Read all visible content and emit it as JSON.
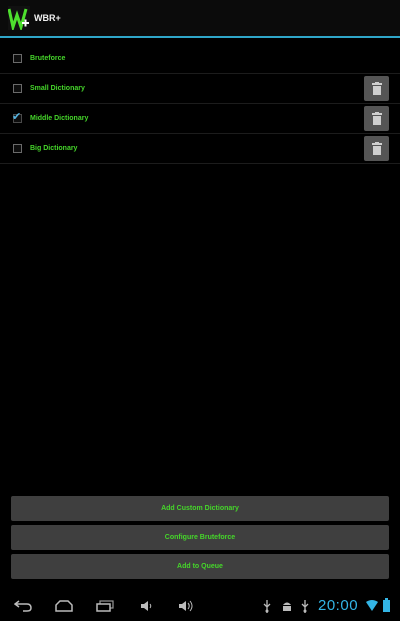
{
  "app": {
    "title": "WBR+"
  },
  "dictionaries": [
    {
      "label": "Bruteforce",
      "checked": false,
      "deletable": false
    },
    {
      "label": "Small Dictionary",
      "checked": false,
      "deletable": true
    },
    {
      "label": "Middle Dictionary",
      "checked": true,
      "deletable": true
    },
    {
      "label": "Big Dictionary",
      "checked": false,
      "deletable": true
    }
  ],
  "buttons": {
    "add_custom": "Add Custom Dictionary",
    "configure": "Configure Bruteforce",
    "add_queue": "Add to Queue"
  },
  "status": {
    "time": "20:00"
  },
  "icons": {
    "delete": "trash-icon",
    "back": "back-icon",
    "home": "home-icon",
    "recent": "recent-apps-icon",
    "vol_down": "volume-down-icon",
    "vol_up": "volume-up-icon",
    "usb": "usb-icon",
    "android": "android-debug-icon",
    "usb2": "usb-icon",
    "wifi": "wifi-icon",
    "battery": "battery-icon"
  },
  "colors": {
    "accent": "#45d62a",
    "holo_blue": "#33b5e5"
  }
}
